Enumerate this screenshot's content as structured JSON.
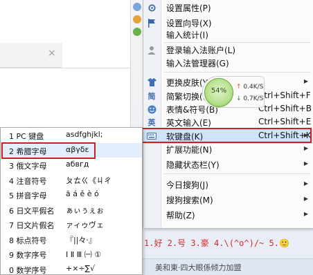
{
  "background": {
    "close_glyph": "×",
    "candidates": "1.好  2.号  3.豪  4.\\(^o^)/~  5.🙂",
    "footer": "美和東·四大眼係倾力加盟"
  },
  "menu": {
    "items": [
      {
        "icon": "wrench-icon",
        "label": "设置属性(P)",
        "shortcut": "",
        "arrow": false
      },
      {
        "icon": "flag-icon",
        "label": "设置向导(X)",
        "shortcut": "",
        "arrow": false
      },
      {
        "icon": "",
        "label": "输入统计(I)",
        "shortcut": "",
        "arrow": false
      },
      {
        "icon": "user-icon",
        "label": "登录输入法账户(L)",
        "shortcut": "",
        "arrow": false
      },
      {
        "icon": "",
        "label": "输入法管理器(G)",
        "shortcut": "",
        "arrow": false
      },
      {
        "icon": "shirt-icon",
        "label": "更换皮肤(Y)",
        "shortcut": "",
        "arrow": true
      },
      {
        "icon": "simplified-icon",
        "label": "简繁切换(F)",
        "shortcut": "Ctrl+Shift+F",
        "arrow": false
      },
      {
        "icon": "smiley-icon",
        "label": "表情&符号(B)",
        "shortcut": "Ctrl+Shift+B",
        "arrow": false
      },
      {
        "icon": "english-icon",
        "label": "英文输入(E)",
        "shortcut": "Ctrl+Shift+E",
        "arrow": false
      },
      {
        "icon": "keyboard-icon",
        "label": "软键盘(K)",
        "shortcut": "Ctrl+Shift+K",
        "arrow": true
      },
      {
        "icon": "",
        "label": "扩展功能(N)",
        "shortcut": "",
        "arrow": true
      },
      {
        "icon": "",
        "label": "隐藏状态栏(Y)",
        "shortcut": "",
        "arrow": true
      },
      {
        "icon": "",
        "label": "今日搜狗(J)",
        "shortcut": "",
        "arrow": true
      },
      {
        "icon": "",
        "label": "搜狗搜索(M)",
        "shortcut": "",
        "arrow": true
      },
      {
        "icon": "",
        "label": "帮助(Z)",
        "shortcut": "",
        "arrow": true
      }
    ],
    "highlighted_index": 9
  },
  "speed_widget": {
    "percent": "54%",
    "up_arrow": "↑",
    "upload": "0.4K/S",
    "down_arrow": "↓",
    "download": "0.7K/S"
  },
  "soft_keyboard_submenu": {
    "items": [
      {
        "name": "1 PC 键盘",
        "preview": "asdfghjkl;"
      },
      {
        "name": "2 希腊字母",
        "preview": "αβγδε"
      },
      {
        "name": "3 俄文字母",
        "preview": "абвгд"
      },
      {
        "name": "4 注音符号",
        "preview": "ㄆㄊㄍ《ㄐㄔ"
      },
      {
        "name": "5 拼音字母",
        "preview": "ā á ě è ó"
      },
      {
        "name": "6 日文平假名",
        "preview": "ぁぃぅぇぉ"
      },
      {
        "name": "7 日文片假名",
        "preview": "ァィゥヴェ"
      },
      {
        "name": "8 标点符号",
        "preview": "『||々·』"
      },
      {
        "name": "9 数字序号",
        "preview": "Ⅰ Ⅱ Ⅲ ㈠ ①"
      },
      {
        "name": "0 数学序号",
        "preview": "+×÷∑√"
      }
    ],
    "highlighted_index": 1
  },
  "colors": {
    "highlight_border": "#cc1f1f",
    "menu_hover": "#cfe3fb",
    "speed_ring": "#7dc043"
  }
}
